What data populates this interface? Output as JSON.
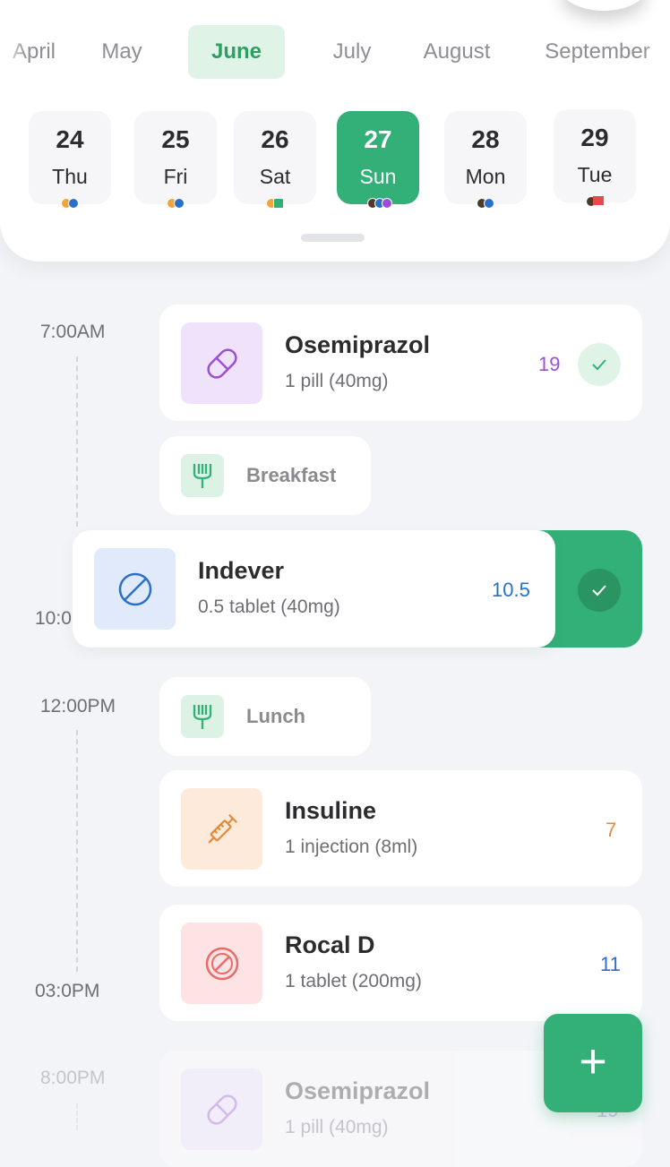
{
  "months": [
    "April",
    "May",
    "June",
    "July",
    "August",
    "September"
  ],
  "days": [
    {
      "num": "24",
      "wd": "Thu"
    },
    {
      "num": "25",
      "wd": "Fri"
    },
    {
      "num": "26",
      "wd": "Sat"
    },
    {
      "num": "27",
      "wd": "Sun"
    },
    {
      "num": "28",
      "wd": "Mon"
    },
    {
      "num": "29",
      "wd": "Tue"
    }
  ],
  "times": {
    "t1": "7:00AM",
    "t2": "10:0",
    "t3": "12:00PM",
    "t4": "03:0PM",
    "t5": "8:00PM"
  },
  "meds": [
    {
      "name": "Osemiprazol",
      "dose": "1 pill (40mg)",
      "count": "19",
      "color": "#9b4fd6"
    },
    {
      "name": "Indever",
      "dose": "0.5 tablet (40mg)",
      "count": "10.5",
      "color": "#2a6fc9"
    },
    {
      "name": "Insuline",
      "dose": "1 injection (8ml)",
      "count": "7",
      "color": "#e38a3c"
    },
    {
      "name": "Rocal D",
      "dose": "1 tablet (200mg)",
      "count": "11",
      "color": "#2a6fc9"
    },
    {
      "name": "Osemiprazol",
      "dose": "1 pill (40mg)",
      "count": "19",
      "color": "#9b4fd6"
    }
  ],
  "meals": {
    "breakfast": "Breakfast",
    "lunch": "Lunch"
  },
  "fab_label": "+",
  "colors": {
    "accent": "#33b077",
    "accent_light": "#dff3e7"
  },
  "icons": [
    "pill-icon",
    "tablet-icon",
    "injection-icon",
    "fork-icon",
    "check-icon",
    "plus-icon"
  ]
}
